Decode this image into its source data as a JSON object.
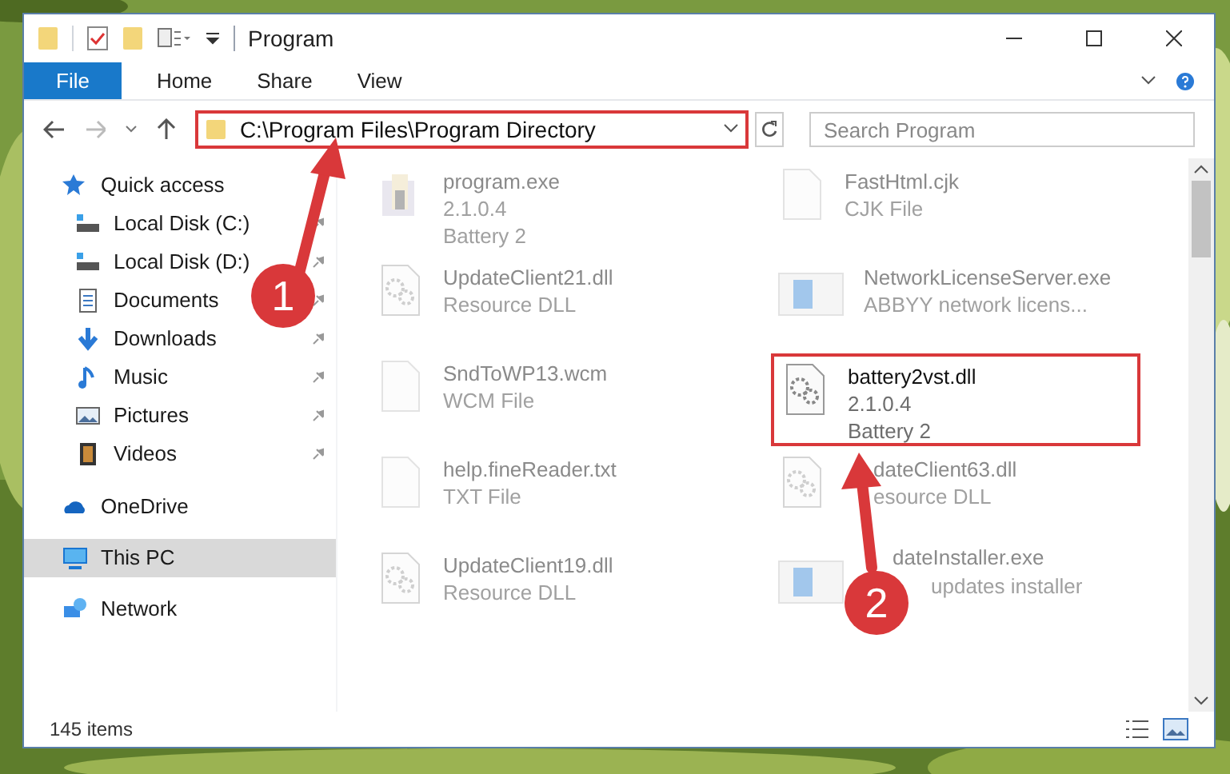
{
  "window": {
    "title": "Program"
  },
  "ribbon_tabs": [
    {
      "label": "File",
      "selected": true
    },
    {
      "label": "Home",
      "selected": false
    },
    {
      "label": "Share",
      "selected": false
    },
    {
      "label": "View",
      "selected": false
    }
  ],
  "address_bar": {
    "value": "C:\\Program Files\\Program Directory",
    "highlighted": true
  },
  "search": {
    "placeholder": "Search Program"
  },
  "sidebar": {
    "items": [
      {
        "label": "Quick access",
        "kind": "quick",
        "pinned": false,
        "selected": false,
        "children": [
          {
            "label": "Local Disk (C:)",
            "kind": "disk",
            "pinned": true,
            "selected": false
          },
          {
            "label": "Local Disk (D:)",
            "kind": "disk",
            "pinned": true,
            "selected": false
          },
          {
            "label": "Documents",
            "kind": "docs",
            "pinned": true,
            "selected": false
          },
          {
            "label": "Downloads",
            "kind": "down",
            "pinned": true,
            "selected": false
          },
          {
            "label": "Music",
            "kind": "music",
            "pinned": true,
            "selected": false
          },
          {
            "label": "Pictures",
            "kind": "pics",
            "pinned": true,
            "selected": false
          },
          {
            "label": "Videos",
            "kind": "video",
            "pinned": true,
            "selected": false
          }
        ]
      },
      {
        "label": "OneDrive",
        "kind": "cloud",
        "pinned": false,
        "selected": false
      },
      {
        "label": "This PC",
        "kind": "pc",
        "pinned": false,
        "selected": true
      },
      {
        "label": "Network",
        "kind": "net",
        "pinned": false,
        "selected": false
      }
    ]
  },
  "files": [
    {
      "name": "program.exe",
      "details": [
        "2.1.0.4",
        "Battery 2"
      ],
      "kind": "app",
      "faded": true,
      "highlighted": false
    },
    {
      "name": "FastHtml.cjk",
      "details": [
        "CJK File"
      ],
      "kind": "blank",
      "faded": true,
      "highlighted": false
    },
    {
      "name": "UpdateClient21.dll",
      "details": [
        "Resource DLL"
      ],
      "kind": "dll",
      "faded": true,
      "highlighted": false
    },
    {
      "name": "NetworkLicenseServer.exe",
      "details": [
        "ABBYY network licens..."
      ],
      "kind": "window",
      "faded": true,
      "highlighted": false
    },
    {
      "name": "SndToWP13.wcm",
      "details": [
        "WCM File"
      ],
      "kind": "blank",
      "faded": true,
      "highlighted": false
    },
    {
      "name": "battery2vst.dll",
      "details": [
        "2.1.0.4",
        "Battery 2"
      ],
      "kind": "dll",
      "faded": false,
      "highlighted": true
    },
    {
      "name": "help.fineReader.txt",
      "details": [
        "TXT File"
      ],
      "kind": "blank",
      "faded": true,
      "highlighted": false
    },
    {
      "name": "dateClient63.dll",
      "details": [
        "esource DLL"
      ],
      "kind": "dll",
      "faded": true,
      "highlighted": false
    },
    {
      "name": "UpdateClient19.dll",
      "details": [
        "Resource DLL"
      ],
      "kind": "dll",
      "faded": true,
      "highlighted": false
    },
    {
      "name": "dateInstaller.exe",
      "details": [
        "updates installer"
      ],
      "kind": "window",
      "faded": true,
      "highlighted": false
    }
  ],
  "status_bar": {
    "count": "145 items"
  },
  "annotations": [
    {
      "number": "1"
    },
    {
      "number": "2"
    }
  ]
}
